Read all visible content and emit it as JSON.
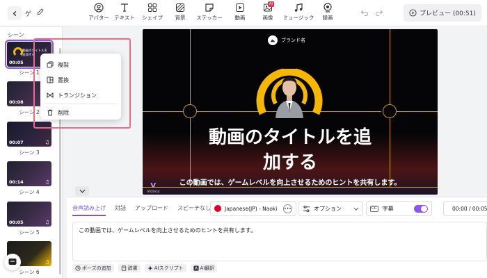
{
  "header": {
    "project_name": "ゲ",
    "tools": [
      {
        "label": "アバター",
        "icon": "avatar-icon"
      },
      {
        "label": "テキスト",
        "icon": "text-icon"
      },
      {
        "label": "シェイプ",
        "icon": "shapes-icon"
      },
      {
        "label": "背景",
        "icon": "background-icon"
      },
      {
        "label": "ステッカー",
        "icon": "sticker-icon"
      },
      {
        "label": "動画",
        "icon": "video-icon"
      },
      {
        "label": "画像",
        "icon": "image-icon",
        "badge": "AI"
      },
      {
        "label": "ミュージック",
        "icon": "music-icon"
      },
      {
        "label": "録画",
        "icon": "record-icon"
      }
    ],
    "preview_label": "プレビュー (00:51)"
  },
  "sidebar": {
    "title": "シーン",
    "scenes": [
      {
        "label": "シーン 1",
        "duration": "00:05",
        "thumb_title": "動画のタイトルを追加する"
      },
      {
        "label": "シーン 2",
        "duration": "00:08"
      },
      {
        "label": "シーン 3",
        "duration": "00:07"
      },
      {
        "label": "シーン 4",
        "duration": "00:14"
      },
      {
        "label": "シーン 5",
        "duration": "00:05"
      },
      {
        "label": "シーン 6",
        "duration": ""
      }
    ]
  },
  "context_menu": {
    "items": [
      {
        "label": "複製",
        "icon": "duplicate-icon"
      },
      {
        "label": "置換",
        "icon": "replace-icon"
      },
      {
        "label": "トランジション",
        "icon": "transition-icon"
      },
      {
        "label": "削除",
        "icon": "trash-icon"
      }
    ]
  },
  "canvas": {
    "brand_name": "ブランド名",
    "title_line1": "動画のタイトルを追",
    "title_line2": "加する",
    "subtitle": "この動画では、ゲームレベルを向上させるためのヒントを共有します。",
    "logo_text": "Vidnoz",
    "accent_color": "#f5b700"
  },
  "script_panel": {
    "tabs": [
      "音声読み上げ",
      "対話",
      "アップロード",
      "スピーチなし"
    ],
    "active_tab": 0,
    "voice": "Japanese(JP) - Naoki",
    "option_label": "オプション",
    "subtitle_label": "字幕",
    "subtitle_on": true,
    "player_time": "00:00 / 00:05",
    "script_text": "この動画では、ゲームレベルを向上させるためのヒントを共有します。",
    "chips": [
      {
        "label": "ポーズの追加",
        "icon": "clock-icon"
      },
      {
        "label": "辞書",
        "icon": "dictionary-icon"
      },
      {
        "label": "AIスクリプト",
        "icon": "ai-script-icon"
      },
      {
        "label": "AI翻訳",
        "icon": "ai-translate-icon"
      }
    ]
  },
  "colors": {
    "accent_purple": "#8a55f5",
    "highlight_pink": "#f06a86"
  }
}
